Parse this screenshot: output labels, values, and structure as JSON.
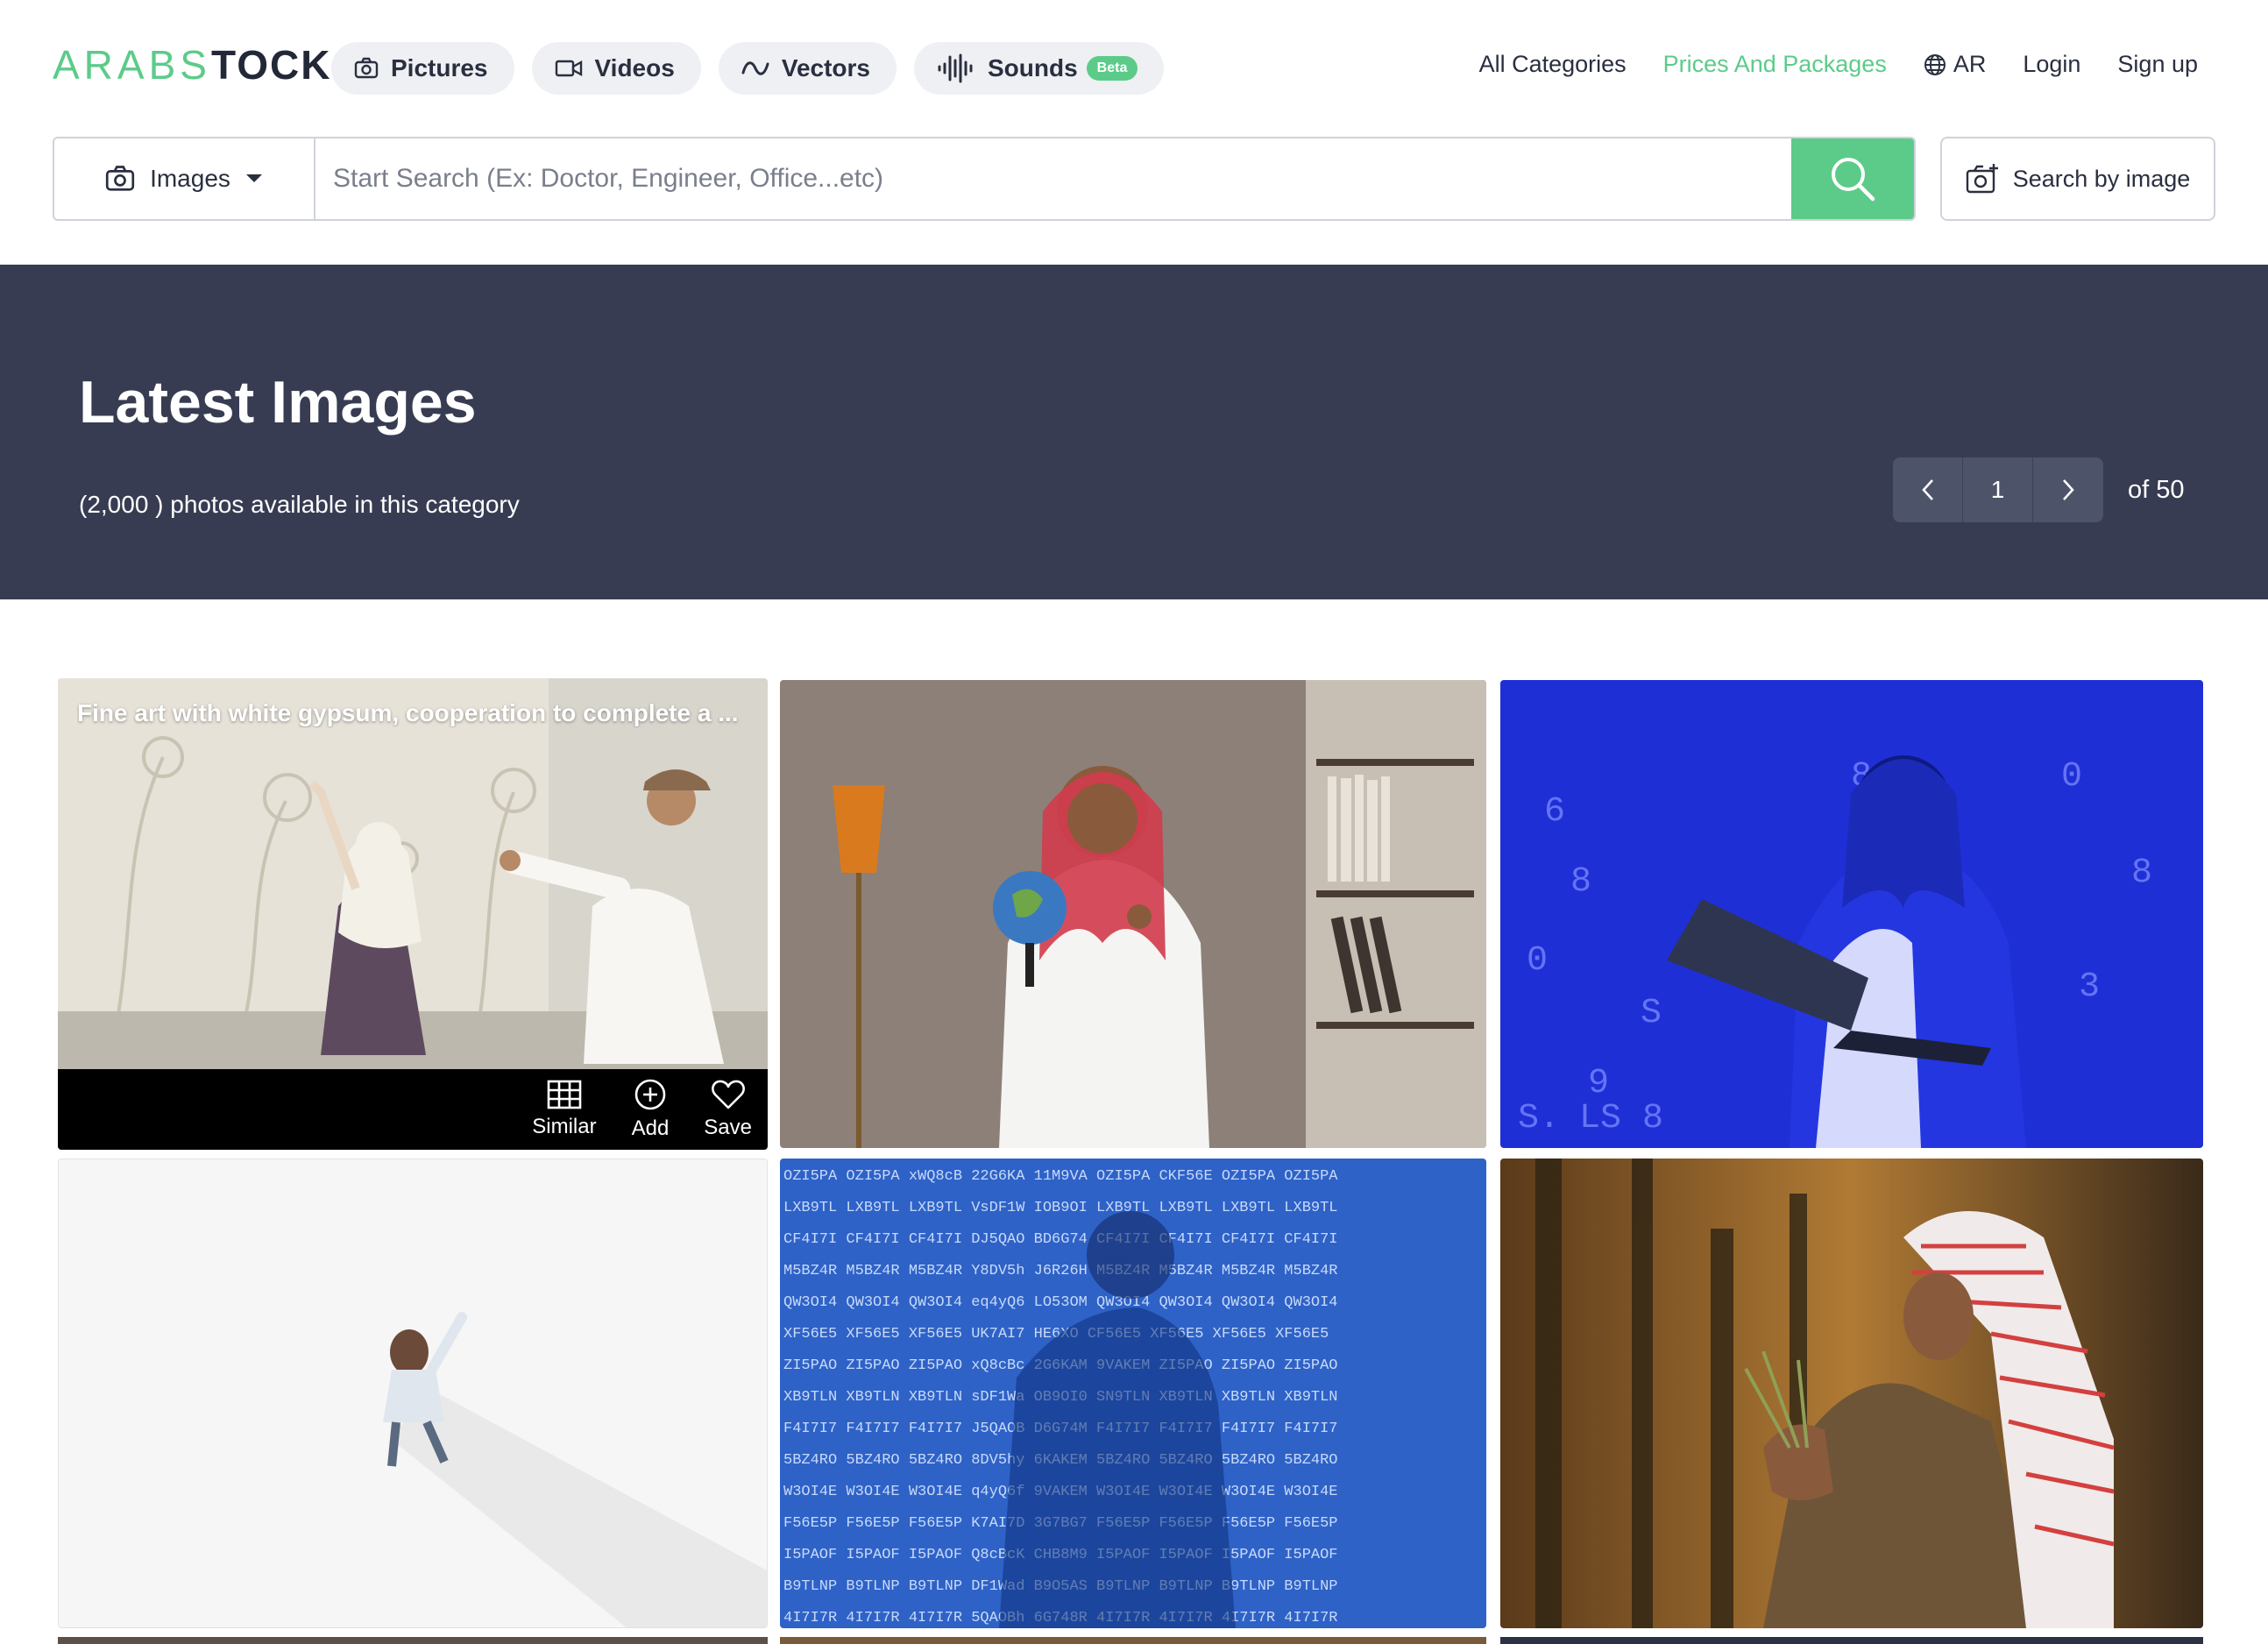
{
  "brand": {
    "logo_part1": "ARABS",
    "logo_part2": "TOCK"
  },
  "media_tabs": [
    {
      "label": "Pictures",
      "icon": "camera-icon"
    },
    {
      "label": "Videos",
      "icon": "video-camera-icon"
    },
    {
      "label": "Vectors",
      "icon": "vector-curve-icon"
    },
    {
      "label": "Sounds",
      "icon": "sound-wave-icon",
      "badge": "Beta"
    }
  ],
  "nav": {
    "all_categories": "All Categories",
    "prices": "Prices And Packages",
    "language": "AR",
    "login": "Login",
    "signup": "Sign up"
  },
  "search": {
    "type_selected": "Images",
    "placeholder": "Start Search (Ex: Doctor, Engineer, Office...etc)",
    "value": "",
    "by_image_label": "Search by image"
  },
  "banner": {
    "title": "Latest Images",
    "count_text": "(2,000 ) photos available in this category",
    "page_current": "1",
    "page_total_text": "of 50"
  },
  "gallery": {
    "items": [
      {
        "caption": "Fine art with white gypsum, cooperation to complete a ...",
        "scene": "gypsum-art"
      },
      {
        "caption": "",
        "scene": "man-with-globe"
      },
      {
        "caption": "",
        "scene": "man-laptop-blue"
      },
      {
        "caption": "",
        "scene": "person-on-white"
      },
      {
        "caption": "",
        "scene": "man-data-code"
      },
      {
        "caption": "",
        "scene": "man-palm-field"
      }
    ],
    "actions": {
      "similar": "Similar",
      "add": "Add",
      "save": "Save"
    }
  },
  "colors": {
    "accent": "#5ccb8a",
    "banner_bg": "#373c52",
    "text_dark": "#2a2f40"
  }
}
